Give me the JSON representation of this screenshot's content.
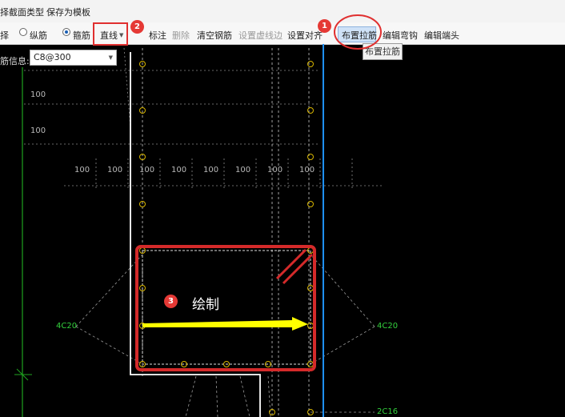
{
  "menubar": {
    "items": [
      "择截面类型",
      "保存为模板"
    ]
  },
  "toolbar": {
    "partial_left": "择",
    "radio_long": "纵筋",
    "radio_stirrup": "箍筋",
    "line_mode": "直线",
    "partial_annot": "标注",
    "delete": "删除",
    "clear": "清空钢筋",
    "set_dashed": "设置虚线边",
    "set_align": "设置对齐",
    "place_tie": "布置拉筋",
    "edit_hook": "编辑弯钩",
    "edit_end": "编辑端头"
  },
  "tooltip": {
    "text": "布置拉筋"
  },
  "rebar_info": {
    "label": "筋信息:",
    "value": "C8@300"
  },
  "cad": {
    "dim_text": "100",
    "labels": {
      "left": "4C20",
      "right": "4C20",
      "bottom": "2C16"
    }
  },
  "annotations": {
    "badge1": "1",
    "badge2": "2",
    "badge3": "3",
    "draw_text": "绘制"
  },
  "colors": {
    "annotation": "#e03030",
    "arrow": "#ffff00",
    "rebar_node": "#d6b400",
    "axis_blue": "#1e90ff",
    "green": "#33d13d",
    "outline_white": "#ffffff"
  }
}
